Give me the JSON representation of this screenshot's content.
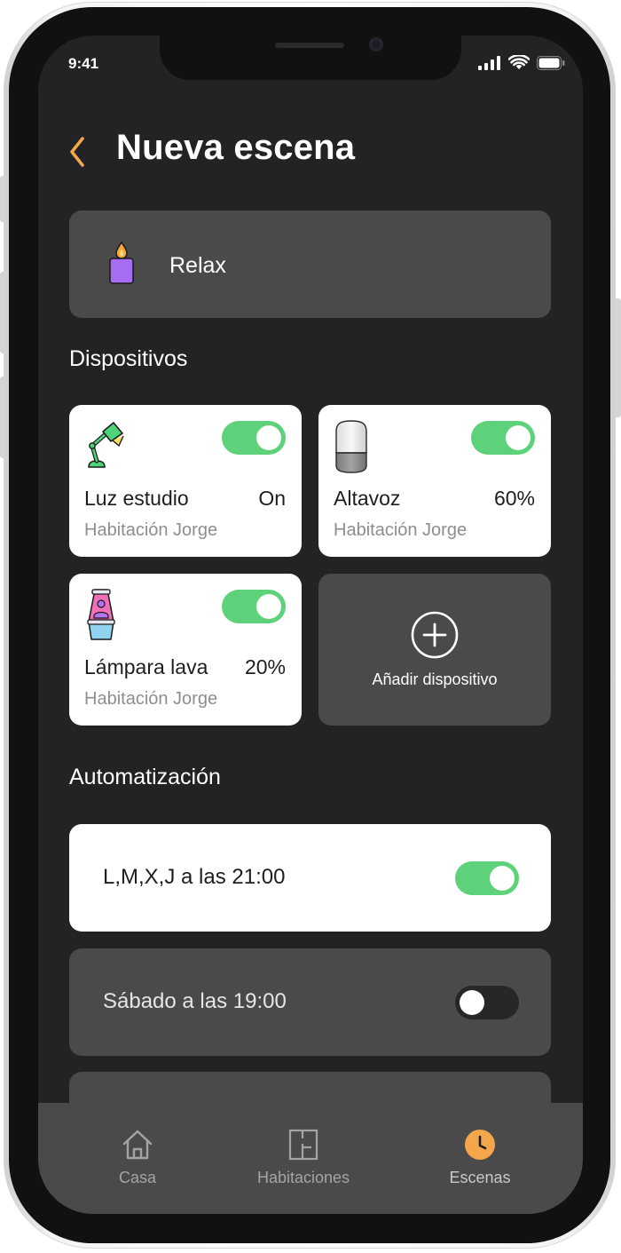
{
  "status": {
    "time": "9:41"
  },
  "header": {
    "title": "Nueva escena"
  },
  "scene": {
    "name": "Relax",
    "icon": "candle-icon"
  },
  "devices_section": {
    "title": "Dispositivos"
  },
  "devices": [
    {
      "name": "Luz estudio",
      "value": "On",
      "room": "Habitación Jorge",
      "icon": "desk-lamp-icon",
      "enabled": true
    },
    {
      "name": "Altavoz",
      "value": "60%",
      "room": "Habitación Jorge",
      "icon": "smart-speaker-icon",
      "enabled": true
    },
    {
      "name": "Lámpara lava",
      "value": "20%",
      "room": "Habitación Jorge",
      "icon": "lava-lamp-icon",
      "enabled": true
    }
  ],
  "add_device": {
    "label": "Añadir dispositivo"
  },
  "automation_section": {
    "title": "Automatización"
  },
  "automations": [
    {
      "label": "L,M,X,J a las 21:00",
      "enabled": true
    },
    {
      "label": "Sábado a las 19:00",
      "enabled": false
    }
  ],
  "tabs": [
    {
      "label": "Casa",
      "icon": "home-icon"
    },
    {
      "label": "Habitaciones",
      "icon": "floorplan-icon"
    },
    {
      "label": "Escenas",
      "icon": "clock-icon",
      "active": true
    }
  ],
  "colors": {
    "accent": "#f4a64a",
    "toggle_on": "#5ed27a",
    "card_dark": "#4a4a4b",
    "background": "#232325"
  }
}
